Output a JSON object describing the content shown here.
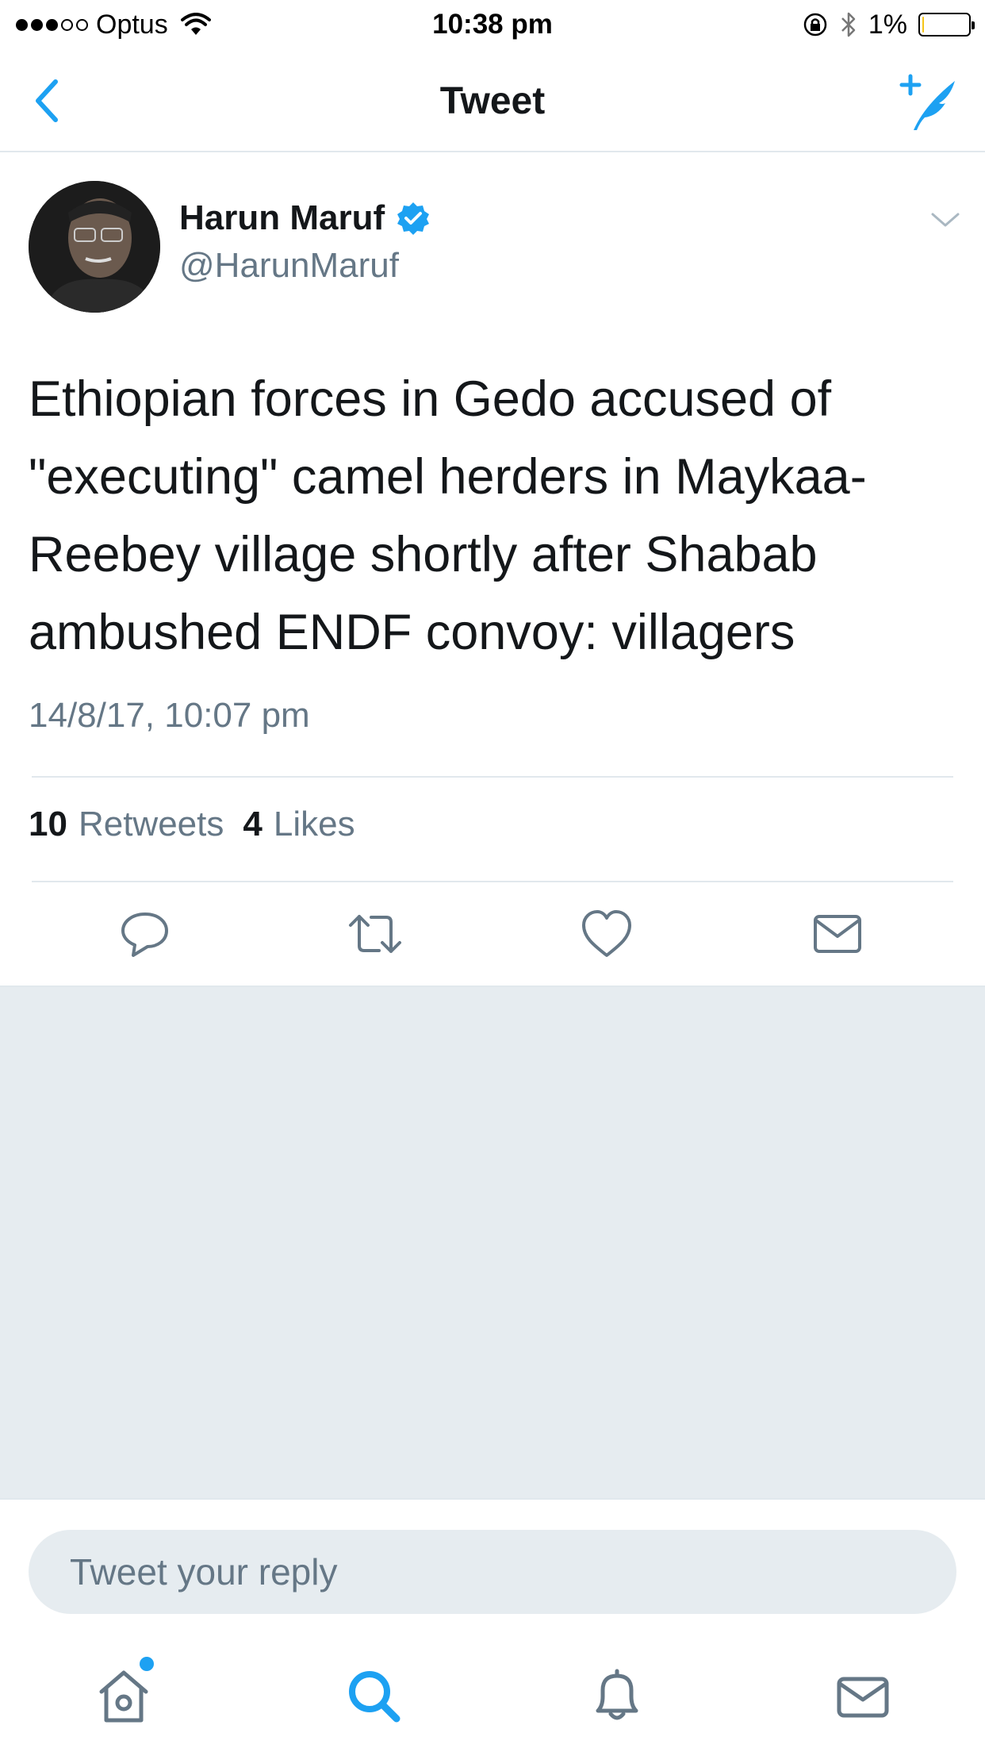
{
  "status_bar": {
    "carrier": "Optus",
    "time": "10:38 pm",
    "battery_pct": "1%",
    "battery_level": 0.01,
    "signal_bars": 3,
    "signal_total": 5
  },
  "nav": {
    "title": "Tweet",
    "back_icon": "chevron-left-icon",
    "compose_icon": "compose-feather-icon"
  },
  "tweet": {
    "author_name": "Harun Maruf",
    "handle": "@HarunMaruf",
    "verified": true,
    "text": "Ethiopian forces in Gedo accused of \"executing\" camel herders in Maykaa-Reebey village shortly after Shabab ambushed ENDF convoy: villagers",
    "timestamp": "14/8/17, 10:07 pm",
    "retweets_count": "10",
    "retweets_label": "Retweets",
    "likes_count": "4",
    "likes_label": "Likes"
  },
  "reply": {
    "placeholder": "Tweet your reply"
  },
  "tabs": [
    {
      "name": "home",
      "icon": "home-icon",
      "active": false,
      "has_notification": true
    },
    {
      "name": "search",
      "icon": "search-icon",
      "active": true
    },
    {
      "name": "notifications",
      "icon": "bell-icon",
      "active": false
    },
    {
      "name": "messages",
      "icon": "mail-icon",
      "active": false
    }
  ],
  "colors": {
    "accent": "#1da1f2",
    "text_primary": "#14171a",
    "text_secondary": "#657786",
    "divider": "#e1e8ed",
    "background_grey": "#e6ecf0"
  }
}
